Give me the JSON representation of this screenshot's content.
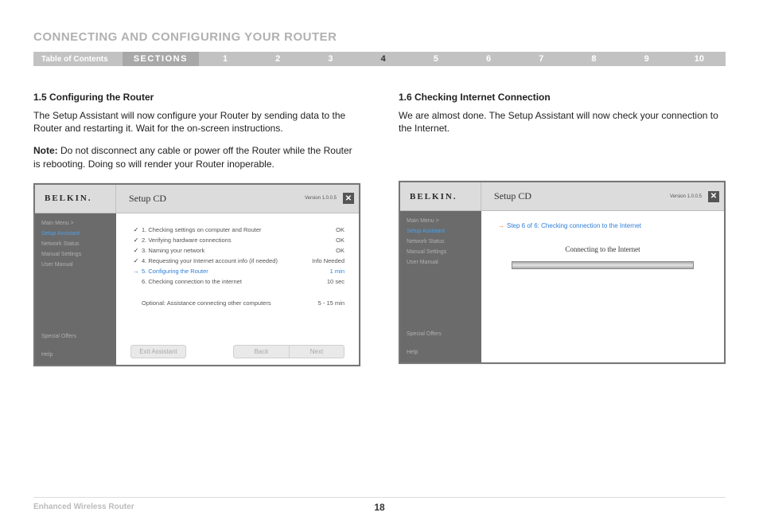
{
  "page": {
    "title": "CONNECTING AND CONFIGURING YOUR ROUTER",
    "footer_title": "Enhanced Wireless Router",
    "page_number": "18"
  },
  "nav": {
    "toc": "Table of Contents",
    "sections_label": "SECTIONS",
    "items": [
      {
        "n": "1",
        "active": false
      },
      {
        "n": "2",
        "active": false
      },
      {
        "n": "3",
        "active": false
      },
      {
        "n": "4",
        "active": true
      },
      {
        "n": "5",
        "active": false
      },
      {
        "n": "6",
        "active": false
      },
      {
        "n": "7",
        "active": false
      },
      {
        "n": "8",
        "active": false
      },
      {
        "n": "9",
        "active": false
      },
      {
        "n": "10",
        "active": false
      }
    ]
  },
  "left": {
    "heading": "1.5 Configuring the Router",
    "para1": "The Setup Assistant will now configure your Router by sending data to the Router and restarting it. Wait for the on-screen instructions.",
    "note_label": "Note:",
    "note_text": " Do not disconnect any cable or power off the Router while the Router is rebooting. Doing so will render your Router inoperable."
  },
  "right": {
    "heading": "1.6 Checking Internet Connection",
    "para1": "We are almost done. The Setup Assistant will now check your connection to the Internet."
  },
  "window_left": {
    "logo": "BELKIN.",
    "title": "Setup CD",
    "version": "Version 1.0.0.5",
    "close": "✕",
    "sidebar": {
      "main_menu": "Main Menu  >",
      "setup_assistant": "Setup Assistant",
      "network_status": "Network Status",
      "manual_settings": "Manual Settings",
      "user_manual": "User Manual",
      "special_offers": "Special Offers",
      "help": "Help"
    },
    "steps": [
      {
        "icon": "check",
        "label": "1. Checking settings on computer and Router",
        "status": "OK",
        "active": false
      },
      {
        "icon": "check",
        "label": "2. Verifying hardware connections",
        "status": "OK",
        "active": false
      },
      {
        "icon": "check",
        "label": "3. Naming your network",
        "status": "OK",
        "active": false
      },
      {
        "icon": "check",
        "label": "4. Requesting your Internet account info (if needed)",
        "status": "Info Needed",
        "active": false
      },
      {
        "icon": "arrow",
        "label": "5. Configuring the Router",
        "status": "1 min",
        "active": true
      },
      {
        "icon": "",
        "label": "6. Checking connection to the internet",
        "status": "10 sec",
        "active": false
      }
    ],
    "optional": {
      "label": "Optional: Assistance connecting other computers",
      "status": "5 - 15 min"
    },
    "buttons": {
      "exit": "Exit Assistant",
      "back": "Back",
      "next": "Next"
    }
  },
  "window_right": {
    "logo": "BELKIN.",
    "title": "Setup CD",
    "version": "Version 1.0.0.5",
    "close": "✕",
    "sidebar": {
      "main_menu": "Main Menu  >",
      "setup_assistant": "Setup Assistant",
      "network_status": "Network Status",
      "manual_settings": "Manual Settings",
      "user_manual": "User Manual",
      "special_offers": "Special Offers",
      "help": "Help"
    },
    "step_header": "Step 6 of 6: Checking connection to the Internet",
    "connecting": "Connecting to the Internet"
  }
}
